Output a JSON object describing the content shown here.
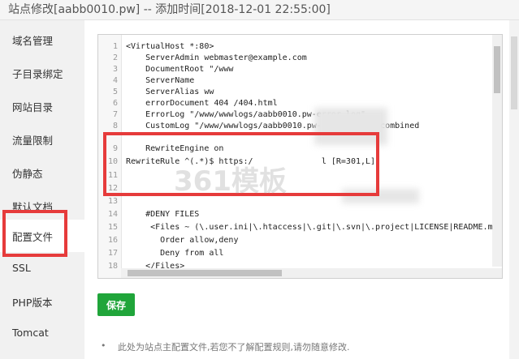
{
  "window": {
    "title": "站点修改[aabb0010.pw] -- 添加时间[2018-12-01 22:55:00]"
  },
  "sidebar": {
    "items": [
      {
        "label": "域名管理"
      },
      {
        "label": "子目录绑定"
      },
      {
        "label": "网站目录"
      },
      {
        "label": "流量限制"
      },
      {
        "label": "伪静态"
      },
      {
        "label": "默认文档"
      },
      {
        "label": "配置文件",
        "active": true
      },
      {
        "label": "SSL"
      },
      {
        "label": "PHP版本"
      },
      {
        "label": "Tomcat"
      }
    ]
  },
  "editor": {
    "line_numbers": [
      "1",
      "2",
      "3",
      "4",
      "5",
      "6",
      "7",
      "8",
      "9",
      "10",
      "11",
      "12",
      "13",
      "14",
      "15",
      "16",
      "17",
      "18"
    ],
    "lines": [
      "<VirtualHost *:80>",
      "    ServerAdmin webmaster@example.com",
      "    DocumentRoot \"/www",
      "    ServerName",
      "    ServerAlias ww",
      "    errorDocument 404 /404.html",
      "    ErrorLog \"/www/wwwlogs/aabb0010.pw-error_log\"",
      "    CustomLog \"/www/wwwlogs/aabb0010.pw-access_log\" combined",
      "    RewriteEngine on",
      "RewriteRule ^(.*)$ https:/              l [R=301,L]",
      "",
      "",
      "",
      "    #DENY FILES",
      "     <Files ~ (\\.user.ini|\\.htaccess|\\.git|\\.svn|\\.project|LICENSE|README.m",
      "       Order allow,deny",
      "       Deny from all",
      "    </Files>"
    ]
  },
  "watermark": {
    "text": "361模板"
  },
  "actions": {
    "save_label": "保存"
  },
  "footer": {
    "note": "此处为站点主配置文件,若您不了解配置规则,请勿随意修改."
  },
  "colors": {
    "save_button": "#20a53a",
    "highlight": "#e63b3b"
  }
}
